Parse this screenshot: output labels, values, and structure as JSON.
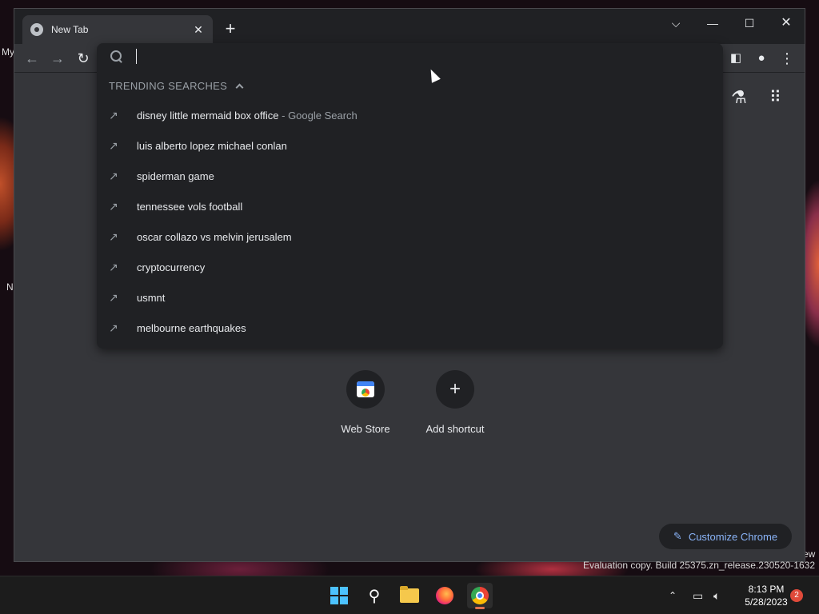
{
  "desktop": {
    "icon_label_1": "My",
    "icon_label_2": "N",
    "icon_label_3": "ew"
  },
  "browser": {
    "tab": {
      "title": "New Tab"
    },
    "newtab_label": "+"
  },
  "omnibox": {
    "value": "",
    "trending_header": "TRENDING SEARCHES",
    "suggestions": [
      {
        "text": "disney little mermaid box office",
        "suffix": " - Google Search"
      },
      {
        "text": "luis alberto lopez michael conlan",
        "suffix": ""
      },
      {
        "text": "spiderman game",
        "suffix": ""
      },
      {
        "text": "tennessee vols football",
        "suffix": ""
      },
      {
        "text": "oscar collazo vs melvin jerusalem",
        "suffix": ""
      },
      {
        "text": "cryptocurrency",
        "suffix": ""
      },
      {
        "text": "usmnt",
        "suffix": ""
      },
      {
        "text": "melbourne earthquakes",
        "suffix": ""
      }
    ]
  },
  "ntp": {
    "shortcuts": [
      {
        "label": "Web Store",
        "icon": "web-store-icon"
      },
      {
        "label": "Add shortcut",
        "icon": "plus-icon"
      }
    ],
    "customize_label": "Customize Chrome"
  },
  "watermark": "Evaluation copy. Build 25375.zn_release.230520-1632",
  "taskbar": {
    "time": "8:13 PM",
    "date": "5/28/2023",
    "notification_count": "2"
  },
  "colors": {
    "accent": "#8ab4f8",
    "window_bg": "#35363a",
    "dropdown_bg": "#202124"
  }
}
